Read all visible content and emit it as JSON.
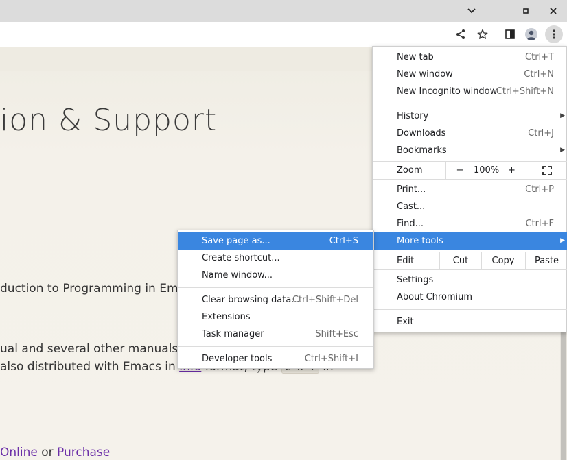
{
  "window_controls": {
    "minimize_icon": "chevron-down-icon",
    "maximize_icon": "maximize-icon",
    "close_icon": "close-icon"
  },
  "page": {
    "title": "ion & Support",
    "line1": "duction to Programming in Emac",
    "line2": "ual and several other manuals d",
    "line3_a": " also distributed with Emacs in ",
    "line3_link": "Info",
    "line3_b": " format, type ",
    "line3_code": "C-h i",
    "line3_c": " in",
    "line4_link1": " Online",
    "line4_or": " or ",
    "line4_link2": "Purchase"
  },
  "menu": {
    "new_tab": {
      "label": "New tab",
      "shortcut": "Ctrl+T"
    },
    "new_window": {
      "label": "New window",
      "shortcut": "Ctrl+N"
    },
    "new_incognito": {
      "label": "New Incognito window",
      "shortcut": "Ctrl+Shift+N"
    },
    "history": {
      "label": "History"
    },
    "downloads": {
      "label": "Downloads",
      "shortcut": "Ctrl+J"
    },
    "bookmarks": {
      "label": "Bookmarks"
    },
    "zoom": {
      "label": "Zoom",
      "minus": "−",
      "value": "100%",
      "plus": "+"
    },
    "print": {
      "label": "Print...",
      "shortcut": "Ctrl+P"
    },
    "cast": {
      "label": "Cast..."
    },
    "find": {
      "label": "Find...",
      "shortcut": "Ctrl+F"
    },
    "more_tools": {
      "label": "More tools"
    },
    "edit": {
      "label": "Edit",
      "cut": "Cut",
      "copy": "Copy",
      "paste": "Paste"
    },
    "settings": {
      "label": "Settings"
    },
    "about": {
      "label": "About Chromium"
    },
    "exit": {
      "label": "Exit"
    }
  },
  "submenu": {
    "save_page": {
      "label": "Save page as...",
      "shortcut": "Ctrl+S"
    },
    "create_shortcut": {
      "label": "Create shortcut..."
    },
    "name_window": {
      "label": "Name window..."
    },
    "clear_data": {
      "label": "Clear browsing data...",
      "shortcut": "Ctrl+Shift+Del"
    },
    "extensions": {
      "label": "Extensions"
    },
    "task_manager": {
      "label": "Task manager",
      "shortcut": "Shift+Esc"
    },
    "dev_tools": {
      "label": "Developer tools",
      "shortcut": "Ctrl+Shift+I"
    }
  },
  "colors": {
    "highlight": "#3a86e0",
    "link": "#6b2fa8",
    "page_bg": "#f4f1ea"
  }
}
